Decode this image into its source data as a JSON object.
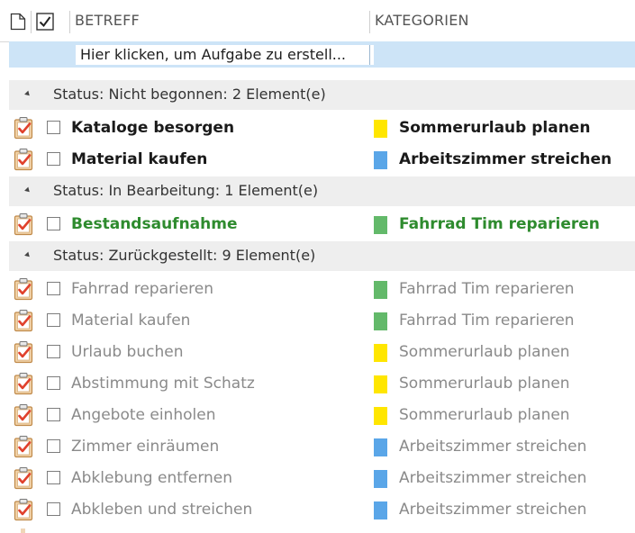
{
  "header": {
    "subject_label": "BETREFF",
    "category_label": "KATEGORIEN",
    "icons": [
      "document-icon",
      "checkbox-checked-icon"
    ]
  },
  "new_task": {
    "placeholder": "Hier klicken, um Aufgabe zu erstell..."
  },
  "colors": {
    "yellow": "#ffe600",
    "blue": "#5aa6e8",
    "green": "#63b96a",
    "accent_green_text": "#2e8b2e",
    "selection_blue": "#cde4f7"
  },
  "groups": [
    {
      "label": "Status: Nicht begonnen: 2 Element(e)",
      "tasks": [
        {
          "subject": "Kataloge besorgen",
          "category": "Sommerurlaub planen",
          "color": "yellow",
          "style": "bold"
        },
        {
          "subject": "Material kaufen",
          "category": "Arbeitszimmer streichen",
          "color": "blue",
          "style": "bold"
        }
      ]
    },
    {
      "label": "Status: In Bearbeitung: 1 Element(e)",
      "tasks": [
        {
          "subject": "Bestandsaufnahme",
          "category": "Fahrrad Tim reparieren",
          "color": "green",
          "style": "green"
        }
      ]
    },
    {
      "label": "Status: Zurückgestellt: 9 Element(e)",
      "tasks": [
        {
          "subject": "Fahrrad reparieren",
          "category": "Fahrrad Tim reparieren",
          "color": "green",
          "style": "grey"
        },
        {
          "subject": "Material kaufen",
          "category": "Fahrrad Tim reparieren",
          "color": "green",
          "style": "grey"
        },
        {
          "subject": "Urlaub buchen",
          "category": "Sommerurlaub planen",
          "color": "yellow",
          "style": "grey"
        },
        {
          "subject": "Abstimmung mit Schatz",
          "category": "Sommerurlaub planen",
          "color": "yellow",
          "style": "grey"
        },
        {
          "subject": "Angebote einholen",
          "category": "Sommerurlaub planen",
          "color": "yellow",
          "style": "grey"
        },
        {
          "subject": "Zimmer einräumen",
          "category": "Arbeitszimmer streichen",
          "color": "blue",
          "style": "grey"
        },
        {
          "subject": "Abklebung entfernen",
          "category": "Arbeitszimmer streichen",
          "color": "blue",
          "style": "grey"
        },
        {
          "subject": "Abkleben und streichen",
          "category": "Arbeitszimmer streichen",
          "color": "blue",
          "style": "grey"
        }
      ]
    }
  ]
}
